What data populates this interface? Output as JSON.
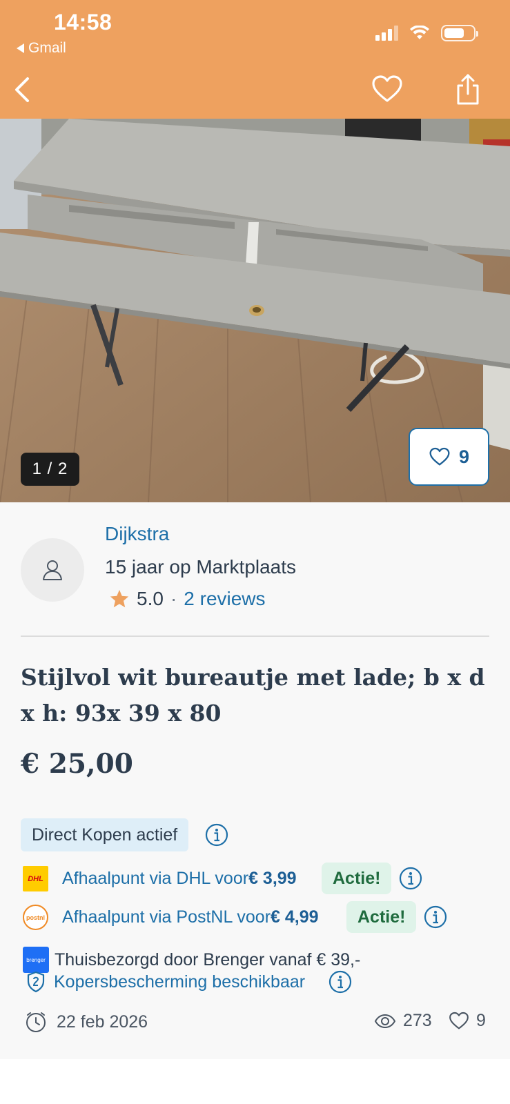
{
  "status_bar": {
    "time": "14:58",
    "back_app": "Gmail"
  },
  "colors": {
    "header_bg": "#eea15f",
    "link_blue": "#1d6fa8",
    "text_dark": "#2d3c4d",
    "actie_bg": "#dff3e9",
    "actie_text": "#1f6b3e",
    "direct_badge_bg": "#deeef8",
    "star": "#eea15f"
  },
  "nav": {
    "back_icon": "chevron-left-icon",
    "favorite_icon": "heart-icon",
    "share_icon": "share-icon"
  },
  "photo": {
    "counter": "1 / 2",
    "favorites_count": "9"
  },
  "seller": {
    "name": "Dijkstra",
    "years": "15 jaar op Marktplaats",
    "rating": "5.0",
    "separator": "·",
    "reviews": "2 reviews"
  },
  "listing": {
    "title": "Stijlvol wit bureautje met lade; b x d x h: 93x 39 x 80",
    "price": "€ 25,00"
  },
  "purchase": {
    "direct_badge": "Direct Kopen actief",
    "dhl": {
      "logo_text": "DHL",
      "label": "Afhaalpunt via DHL voor ",
      "price": "€ 3,99",
      "badge": "Actie!"
    },
    "postnl": {
      "logo_text": "postnl",
      "label": "Afhaalpunt via PostNL voor ",
      "price": "€ 4,99",
      "badge": "Actie!"
    },
    "brenger": {
      "logo_text": "brenger",
      "label": "Thuisbezorgd door Brenger vanaf € 39,-"
    },
    "protection": "Kopersbescherming beschikbaar"
  },
  "meta": {
    "date": "22 feb 2026",
    "views": "273",
    "likes": "9"
  }
}
